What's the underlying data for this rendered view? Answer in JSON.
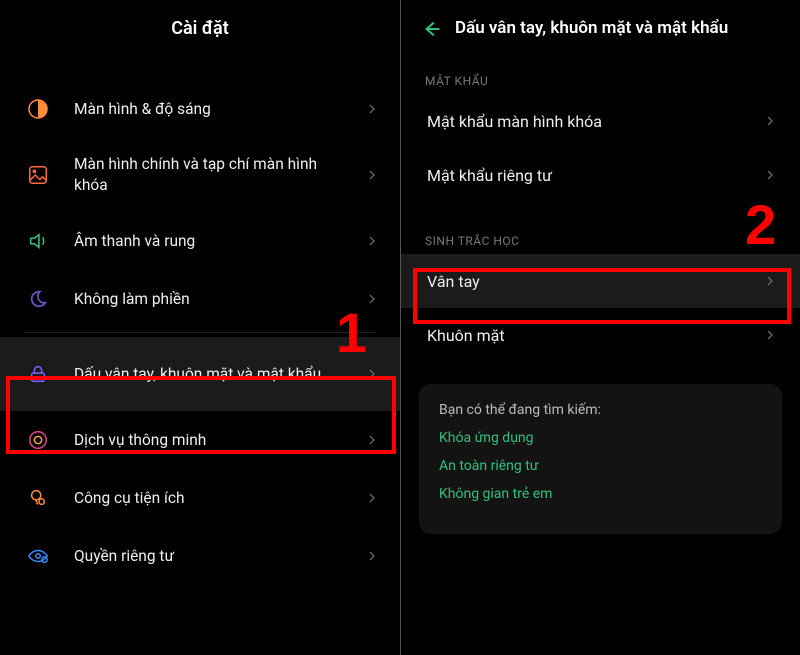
{
  "left": {
    "title": "Cài đặt",
    "items": [
      {
        "icon": "display-brightness-icon",
        "label": "Màn hình & độ sáng"
      },
      {
        "icon": "home-lockscreen-icon",
        "label": "Màn hình chính và tạp chí màn hình khóa"
      },
      {
        "icon": "sound-vibration-icon",
        "label": "Âm thanh và rung"
      },
      {
        "icon": "dnd-moon-icon",
        "label": "Không làm phiền"
      },
      {
        "icon": "lock-icon",
        "label": "Dấu vân tay, khuôn mặt và mật khẩu"
      },
      {
        "icon": "smart-service-icon",
        "label": "Dịch vụ thông minh"
      },
      {
        "icon": "tools-icon",
        "label": "Công cụ tiện ích"
      },
      {
        "icon": "privacy-eye-icon",
        "label": "Quyền riêng tư"
      }
    ]
  },
  "right": {
    "title": "Dấu vân tay, khuôn mặt và mật khẩu",
    "sections": {
      "password": {
        "header": "MẬT KHẨU",
        "items": [
          {
            "label": "Mật khẩu màn hình khóa"
          },
          {
            "label": "Mật khẩu riêng tư"
          }
        ]
      },
      "biometric": {
        "header": "SINH TRẮC HỌC",
        "items": [
          {
            "label": "Vân tay"
          },
          {
            "label": "Khuôn mặt"
          }
        ]
      }
    },
    "card": {
      "title": "Bạn có thể đang tìm kiếm:",
      "links": [
        "Khóa ứng dụng",
        "An toàn riêng tư",
        "Không gian trẻ em"
      ]
    }
  },
  "annotations": {
    "n1": "1",
    "n2": "2"
  }
}
